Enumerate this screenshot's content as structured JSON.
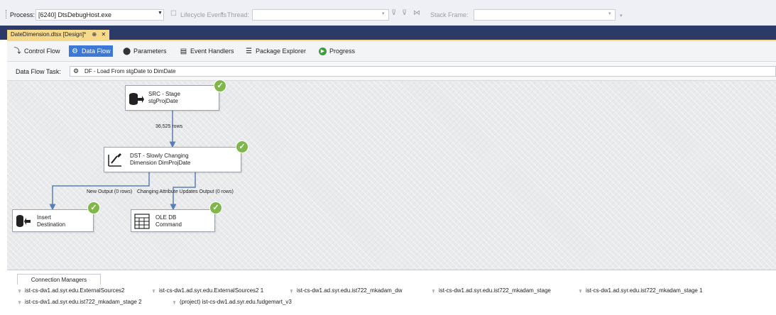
{
  "debug_toolbar": {
    "process_label": "Process:",
    "process_value": "[6240] DtsDebugHost.exe",
    "lifecycle_label": "Lifecycle Events",
    "thread_label": "Thread:",
    "stack_frame_label": "Stack Frame:"
  },
  "document_tab": {
    "title": "DateDimension.dtsx [Design]*",
    "pin_glyph": "⊕",
    "close_glyph": "✕"
  },
  "designer_tabs": [
    {
      "label": "Control Flow",
      "active": false
    },
    {
      "label": "Data Flow",
      "active": true
    },
    {
      "label": "Parameters",
      "active": false
    },
    {
      "label": "Event Handlers",
      "active": false
    },
    {
      "label": "Package Explorer",
      "active": false
    },
    {
      "label": "Progress",
      "active": false
    }
  ],
  "task": {
    "label": "Data Flow Task:",
    "value": "DF - Load From stgDate to DimDate"
  },
  "components": {
    "src": {
      "line1": "SRC - Stage",
      "line2": "stgProjDate"
    },
    "dst": {
      "line1": "DST - Slowly Changing",
      "line2": "Dimension DimProjDate"
    },
    "insert": {
      "line1": "Insert",
      "line2": "Destination"
    },
    "oledb": {
      "line1": "OLE DB",
      "line2": "Command"
    }
  },
  "flows": {
    "rows": "36,525 rows",
    "new_output": "New Output (0 rows)",
    "changing_output": "Changing Attribute Updates Output (0 rows)"
  },
  "connection_managers": {
    "tab_label": "Connection Managers",
    "items": [
      "ist-cs-dw1.ad.syr.edu.ExternalSources2",
      "ist-cs-dw1.ad.syr.edu.ExternalSources2 1",
      "ist-cs-dw1.ad.syr.edu.ist722_mkadam_dw",
      "ist-cs-dw1.ad.syr.edu.ist722_mkadam_stage",
      "ist-cs-dw1.ad.syr.edu.ist722_mkadam_stage 1",
      "ist-cs-dw1.ad.syr.edu.ist722_mkadam_stage 2",
      "(project) ist-cs-dw1.ad.syr.edu.fudgemart_v3"
    ]
  },
  "colors": {
    "accent": "#3c78d8",
    "doc_tab": "#f6d98a",
    "title_strip": "#2b3a67",
    "success": "#7fb74a",
    "flow_arrow": "#5b7fb5"
  },
  "icons": [
    "control-flow-icon",
    "data-flow-icon",
    "parameters-icon",
    "event-handlers-icon",
    "package-explorer-icon",
    "progress-icon",
    "check-icon",
    "plug-icon"
  ]
}
